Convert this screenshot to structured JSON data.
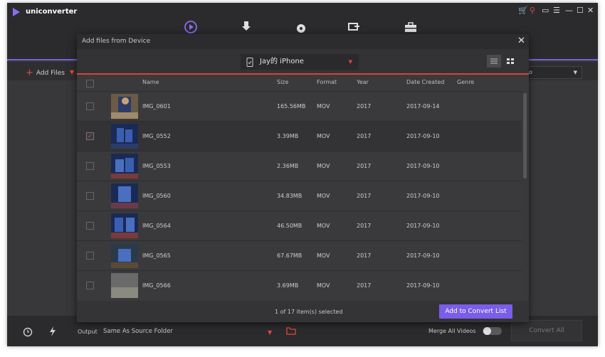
{
  "app": {
    "name": "uniconverter",
    "toolbar": {
      "add_files": "Add Files",
      "right_select_value": "o"
    },
    "bottom": {
      "output_label": "Output",
      "output_value": "Same As Source Folder",
      "merge_label": "Merge All Videos",
      "convert_all": "Convert All"
    }
  },
  "dialog": {
    "title": "Add files from Device",
    "device": "Jay的 iPhone",
    "columns": [
      "Name",
      "Size",
      "Format",
      "Year",
      "Date Created",
      "Genre"
    ],
    "rows": [
      {
        "name": "IMG_0601",
        "size": "165.56MB",
        "format": "MOV",
        "year": "2017",
        "date": "2017-09-14",
        "checked": false
      },
      {
        "name": "IMG_0552",
        "size": "3.39MB",
        "format": "MOV",
        "year": "2017",
        "date": "2017-09-10",
        "checked": true
      },
      {
        "name": "IMG_0553",
        "size": "2.36MB",
        "format": "MOV",
        "year": "2017",
        "date": "2017-09-10",
        "checked": false
      },
      {
        "name": "IMG_0560",
        "size": "34.83MB",
        "format": "MOV",
        "year": "2017",
        "date": "2017-09-10",
        "checked": false
      },
      {
        "name": "IMG_0564",
        "size": "46.50MB",
        "format": "MOV",
        "year": "2017",
        "date": "2017-09-10",
        "checked": false
      },
      {
        "name": "IMG_0565",
        "size": "67.67MB",
        "format": "MOV",
        "year": "2017",
        "date": "2017-09-10",
        "checked": false
      },
      {
        "name": "IMG_0566",
        "size": "3.69MB",
        "format": "MOV",
        "year": "2017",
        "date": "2017-09-10",
        "checked": false
      }
    ],
    "selection_status": "1 of 17 item(s) selected",
    "add_button": "Add to Convert List"
  },
  "colors": {
    "accent": "#7a5de8",
    "red": "#e5473d"
  }
}
